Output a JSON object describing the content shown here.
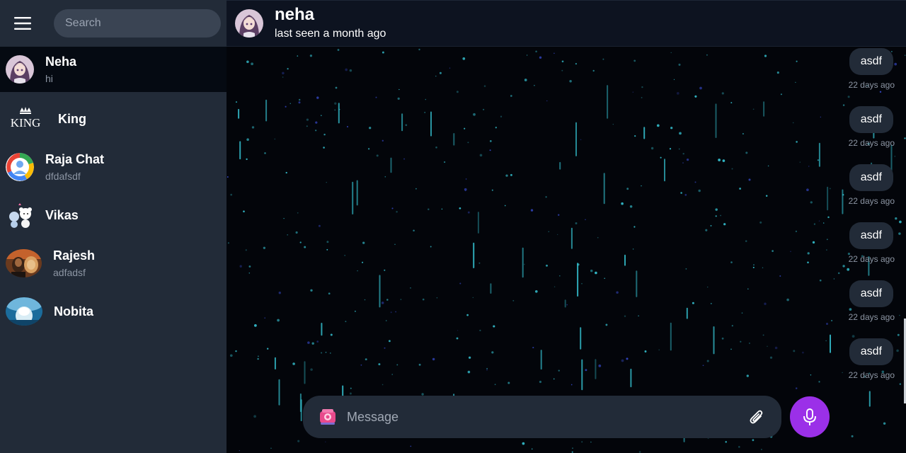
{
  "sidebar": {
    "menu_icon": "hamburger-menu-icon",
    "search_placeholder": "Search",
    "chats": [
      {
        "name": "Neha",
        "preview": "hi",
        "active": true,
        "avatar": "anime-girl"
      },
      {
        "name": "King",
        "preview": "",
        "active": false,
        "avatar": "king-crown-logo"
      },
      {
        "name": "Raja Chat",
        "preview": "dfdafsdf",
        "active": false,
        "avatar": "group-people"
      },
      {
        "name": "Vikas",
        "preview": "",
        "active": false,
        "avatar": "cartoon-bears"
      },
      {
        "name": "Rajesh",
        "preview": "adfadsf",
        "active": false,
        "avatar": "man-with-lion"
      },
      {
        "name": "Nobita",
        "preview": "",
        "active": false,
        "avatar": "cartoon-blue"
      }
    ]
  },
  "header": {
    "name": "neha",
    "status": "last seen a month ago"
  },
  "messages": [
    {
      "text": "asdf",
      "time": "22 days ago"
    },
    {
      "text": "asdf",
      "time": "22 days ago"
    },
    {
      "text": "asdf",
      "time": "22 days ago"
    },
    {
      "text": "asdf",
      "time": "22 days ago"
    },
    {
      "text": "asdf",
      "time": "22 days ago"
    },
    {
      "text": "asdf",
      "time": "22 days ago"
    }
  ],
  "composer": {
    "placeholder": "Message",
    "emoji_icon": "sticker-emoji-icon",
    "attach_icon": "paperclip-icon",
    "mic_icon": "microphone-icon"
  },
  "colors": {
    "sidebar_bg": "#222b38",
    "active_chat_bg": "#050a12",
    "mic_button": "#9b30e8",
    "star_color": "#3ad6e6"
  }
}
